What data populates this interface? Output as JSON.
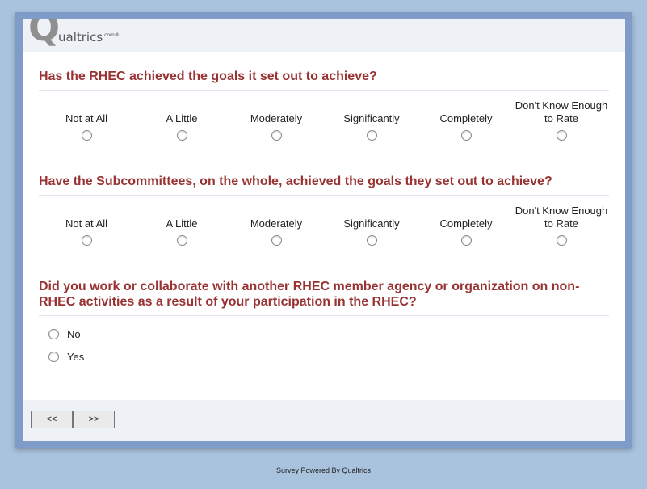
{
  "logo": {
    "mark": "Q",
    "text": "ualtrics",
    "suffix": ".com",
    "tm": "®"
  },
  "questions": [
    {
      "title": "Has the RHEC achieved the goals it set out to achieve?",
      "options": [
        "Not at All",
        "A Little",
        "Moderately",
        "Significantly",
        "Completely",
        "Don't Know Enough to Rate"
      ]
    },
    {
      "title": "Have the Subcommittees, on the whole, achieved the goals they set out to achieve?",
      "options": [
        "Not at All",
        "A Little",
        "Moderately",
        "Significantly",
        "Completely",
        "Don't Know Enough to Rate"
      ]
    },
    {
      "title": "Did you work or collaborate with another RHEC member agency or organization on non-RHEC activities as a result of your participation in the RHEC?",
      "options": [
        "No",
        "Yes"
      ]
    }
  ],
  "nav": {
    "back_label": "<<",
    "next_label": ">>"
  },
  "footer": {
    "prefix": "Survey Powered By",
    "link": "Qualtrics"
  }
}
